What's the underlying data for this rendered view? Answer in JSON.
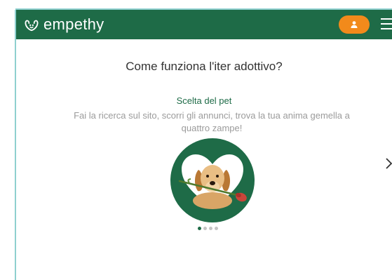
{
  "header": {
    "brand": "empethy",
    "logo_icon": "paw-heart-icon",
    "user_icon": "user-icon",
    "menu_icon": "hamburger-menu-icon",
    "brand_color": "#1e6b47",
    "accent_color": "#f28a1b"
  },
  "main": {
    "title": "Come funziona l'iter adottivo?",
    "step": {
      "title": "Scelta del pet",
      "description": "Fai la ricerca sul sito, scorri gli annunci, trova la tua anima gemella a quattro zampe!",
      "image_icon": "dog-heart-icon"
    },
    "carousel": {
      "next_icon": "chevron-right-icon",
      "total_steps": 4,
      "active_step": 1
    }
  }
}
